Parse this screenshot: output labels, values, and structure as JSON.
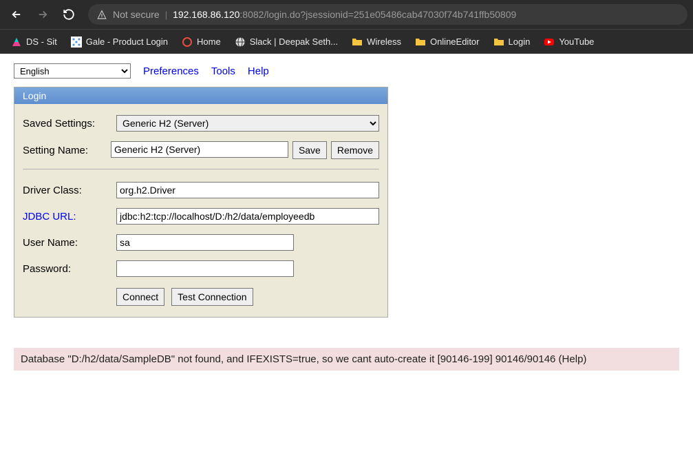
{
  "browser": {
    "not_secure": "Not secure",
    "url_host": "192.168.86.120",
    "url_port": ":8082",
    "url_path": "/login.do?jsessionid=251e05486cab47030f74b741ffb50809"
  },
  "bookmarks": [
    {
      "label": "DS - Sit",
      "icon": "colorful"
    },
    {
      "label": "Gale - Product Login",
      "icon": "dots"
    },
    {
      "label": "Home",
      "icon": "circle-o"
    },
    {
      "label": "Slack | Deepak Seth...",
      "icon": "globe"
    },
    {
      "label": "Wireless",
      "icon": "folder"
    },
    {
      "label": "OnlineEditor",
      "icon": "folder"
    },
    {
      "label": "Login",
      "icon": "folder"
    },
    {
      "label": "YouTube",
      "icon": "youtube"
    }
  ],
  "top": {
    "language": "English",
    "preferences": "Preferences",
    "tools": "Tools",
    "help": "Help"
  },
  "login": {
    "title": "Login",
    "saved_settings_label": "Saved Settings:",
    "saved_settings_value": "Generic H2 (Server)",
    "setting_name_label": "Setting Name:",
    "setting_name_value": "Generic H2 (Server)",
    "save": "Save",
    "remove": "Remove",
    "driver_class_label": "Driver Class:",
    "driver_class_value": "org.h2.Driver",
    "jdbc_url_label": "JDBC URL:",
    "jdbc_url_value": "jdbc:h2:tcp://localhost/D:/h2/data/employeedb",
    "user_name_label": "User Name:",
    "user_name_value": "sa",
    "password_label": "Password:",
    "password_value": "",
    "connect": "Connect",
    "test_connection": "Test Connection"
  },
  "error": "Database \"D:/h2/data/SampleDB\" not found, and IFEXISTS=true, so we cant auto-create it [90146-199] 90146/90146 (Help)"
}
